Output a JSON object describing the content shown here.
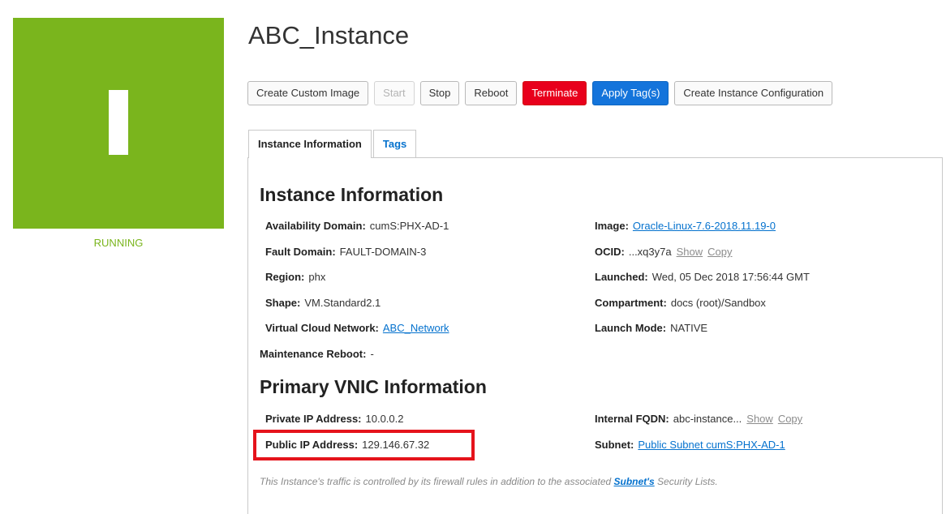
{
  "colors": {
    "running": "#7ab51d",
    "terminate": "#e8001c",
    "primary": "#1474db",
    "link": "#0572ce",
    "highlight": "#e5131b"
  },
  "status": {
    "state": "RUNNING",
    "icon_letter": "I"
  },
  "title": "ABC_Instance",
  "actions": {
    "create_custom_image": "Create Custom Image",
    "start": "Start",
    "stop": "Stop",
    "reboot": "Reboot",
    "terminate": "Terminate",
    "apply_tags": "Apply Tag(s)",
    "create_instance_configuration": "Create Instance Configuration"
  },
  "tabs": {
    "instance_information": "Instance Information",
    "tags": "Tags"
  },
  "instance_info": {
    "heading": "Instance Information",
    "availability_domain": {
      "label": "Availability Domain:",
      "value": "cumS:PHX-AD-1"
    },
    "fault_domain": {
      "label": "Fault Domain:",
      "value": "FAULT-DOMAIN-3"
    },
    "region": {
      "label": "Region:",
      "value": "phx"
    },
    "shape": {
      "label": "Shape:",
      "value": "VM.Standard2.1"
    },
    "vcn": {
      "label": "Virtual Cloud Network:",
      "value": "ABC_Network"
    },
    "maintenance_reboot": {
      "label": "Maintenance Reboot:",
      "value": "-"
    },
    "image": {
      "label": "Image:",
      "value": "Oracle-Linux-7.6-2018.11.19-0"
    },
    "ocid": {
      "label": "OCID:",
      "value": "...xq3y7a",
      "show": "Show",
      "copy": "Copy"
    },
    "launched": {
      "label": "Launched:",
      "value": "Wed, 05 Dec 2018 17:56:44 GMT"
    },
    "compartment": {
      "label": "Compartment:",
      "value": "docs (root)/Sandbox"
    },
    "launch_mode": {
      "label": "Launch Mode:",
      "value": "NATIVE"
    }
  },
  "vnic_info": {
    "heading": "Primary VNIC Information",
    "private_ip": {
      "label": "Private IP Address:",
      "value": "10.0.0.2"
    },
    "public_ip": {
      "label": "Public IP Address:",
      "value": "129.146.67.32"
    },
    "internal_fqdn": {
      "label": "Internal FQDN:",
      "value": "abc-instance...",
      "show": "Show",
      "copy": "Copy"
    },
    "subnet": {
      "label": "Subnet:",
      "value": "Public Subnet cumS:PHX-AD-1"
    }
  },
  "footnote": {
    "before": "This Instance's traffic is controlled by its firewall rules in addition to the associated ",
    "link": "Subnet's",
    "after": " Security Lists."
  }
}
